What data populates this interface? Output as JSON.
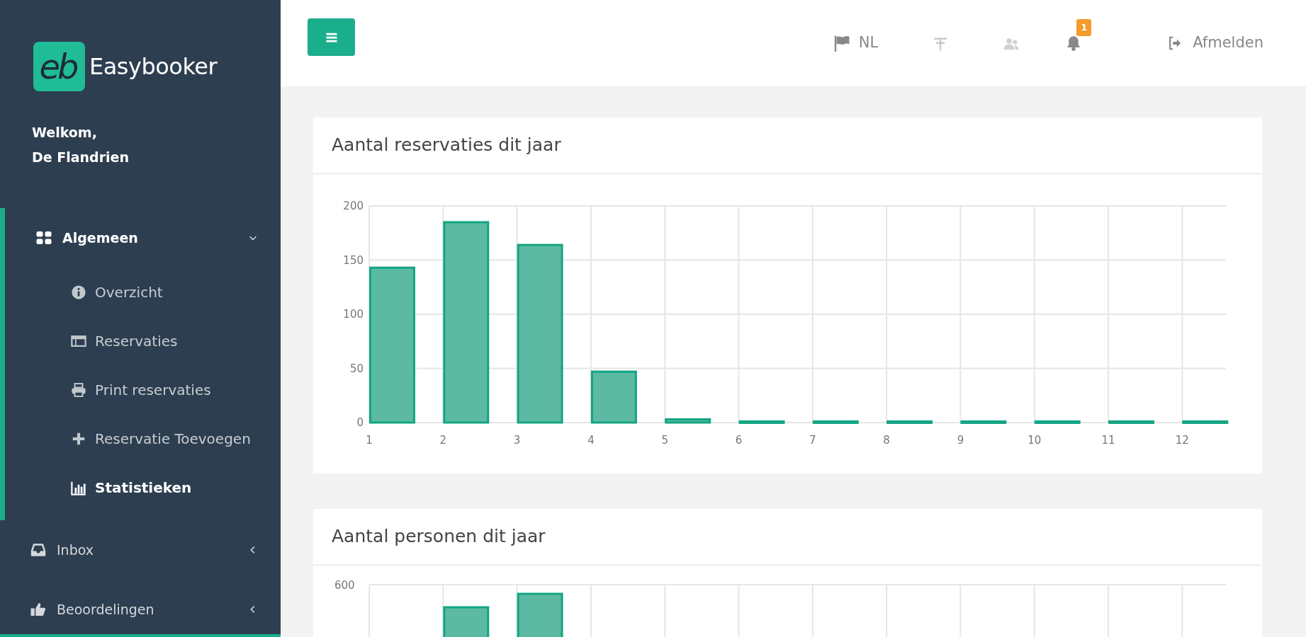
{
  "sidebar": {
    "logo": {
      "mark": "eb",
      "text": "Easybooker"
    },
    "welcome": [
      "Welkom,",
      "De Flandrien"
    ],
    "menu": [
      {
        "label": "Algemeen",
        "expanded": true,
        "children": [
          {
            "label": "Overzicht",
            "selected": false
          },
          {
            "label": "Reservaties",
            "selected": false
          },
          {
            "label": "Print reservaties",
            "selected": false
          },
          {
            "label": "Reservatie Toevoegen",
            "selected": false
          },
          {
            "label": "Statistieken",
            "selected": true
          }
        ]
      },
      {
        "label": "Inbox",
        "expanded": false
      },
      {
        "label": "Beoordelingen",
        "expanded": false
      }
    ]
  },
  "topbar": {
    "language": "NL",
    "notifications_badge": "1",
    "logout": "Afmelden"
  },
  "panels": [
    {
      "title": "Aantal reservaties dit jaar",
      "chart_data": {
        "type": "bar",
        "categories": [
          "1",
          "2",
          "3",
          "4",
          "5",
          "6",
          "7",
          "8",
          "9",
          "10",
          "11",
          "12"
        ],
        "grid": true,
        "series": [
          {
            "color": "#5cbaa2",
            "values": [
              143,
              185,
              164,
              47,
              3,
              1,
              1,
              1,
              1,
              1,
              1,
              1
            ]
          }
        ],
        "ylim": [
          0,
          200
        ],
        "yticks": [
          0,
          50,
          100,
          150,
          200
        ]
      }
    },
    {
      "title": "Aantal personen dit jaar",
      "y_tick_label": "600"
    }
  ]
}
